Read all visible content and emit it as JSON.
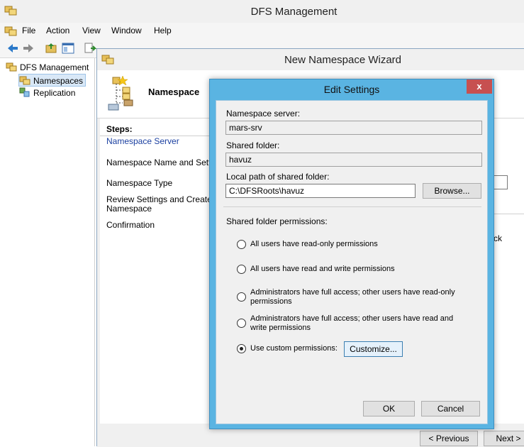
{
  "main_window": {
    "title": "DFS Management",
    "menu": [
      "File",
      "Action",
      "View",
      "Window",
      "Help"
    ],
    "tree": {
      "root": "DFS Management",
      "items": [
        "Namespaces",
        "Replication"
      ],
      "selected": "Namespaces"
    }
  },
  "wizard": {
    "title": "New Namespace Wizard",
    "header_title": "Namespace",
    "steps_label": "Steps:",
    "steps": [
      "Namespace Server",
      "Namespace Name and Settings",
      "Namespace Type",
      "Review Settings and Create Namespace",
      "Confirmation"
    ],
    "active_step": "Namespace Server",
    "content_fragment_1": "n",
    "content_fragment_2": "ck",
    "previous_button": "< Previous",
    "next_button": "Next >"
  },
  "dialog": {
    "title": "Edit Settings",
    "close_glyph": "x",
    "namespace_server_label": "Namespace server:",
    "namespace_server_value": "mars-srv",
    "shared_folder_label": "Shared folder:",
    "shared_folder_value": "havuz",
    "local_path_label": "Local path of shared folder:",
    "local_path_value": "C:\\DFSRoots\\havuz",
    "browse_button": "Browse...",
    "permissions_label": "Shared folder permissions:",
    "permission_options": [
      "All users have read-only permissions",
      "All users have read and write permissions",
      "Administrators have full access; other users have read-only permissions",
      "Administrators have full access; other users have read and write permissions",
      "Use custom permissions:"
    ],
    "selected_permission_index": 4,
    "customize_button": "Customize...",
    "ok_button": "OK",
    "cancel_button": "Cancel"
  },
  "colors": {
    "dialog_frame": "#5ab4e2",
    "close_button": "#c75050",
    "active_step_text": "#1a3fa0"
  }
}
